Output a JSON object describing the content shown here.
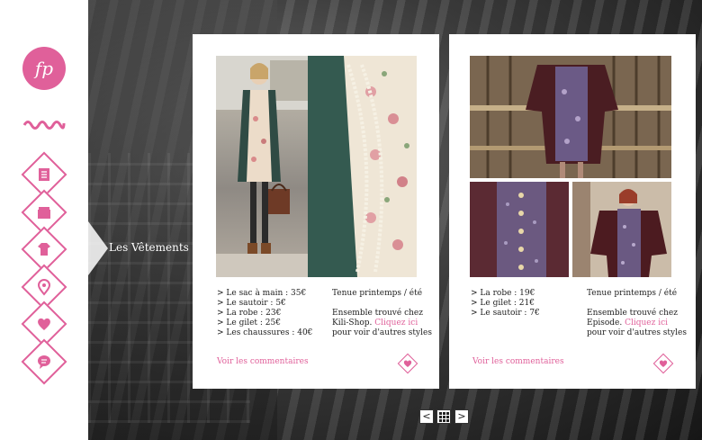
{
  "brand": {
    "logo_text": "fp",
    "accent": "#e0609a"
  },
  "nav": {
    "items": [
      {
        "id": "journal",
        "icon": "notebook-icon"
      },
      {
        "id": "shop",
        "icon": "shopping-bag-icon"
      },
      {
        "id": "clothes",
        "icon": "dress-icon"
      },
      {
        "id": "location",
        "icon": "location-pin-icon"
      },
      {
        "id": "favorites",
        "icon": "heart-icon"
      },
      {
        "id": "comments",
        "icon": "speech-bubble-icon"
      }
    ],
    "active_label": "Les Vêtements"
  },
  "cards": [
    {
      "items": [
        "> Le sac à main : 35€",
        "> Le sautoir : 5€",
        "> La robe : 23€",
        "> Le gilet : 25€",
        "> Les chaussures : 40€"
      ],
      "title": "Tenue  printemps / été",
      "found_line1": "Ensemble trouvé chez",
      "shop": "Kili-Shop.",
      "click_here": "Cliquez ici",
      "more_styles": "pour voir d'autres styles",
      "comments_link": "Voir les commentaires"
    },
    {
      "items": [
        "> La robe : 19€",
        "> Le gilet : 21€",
        "> Le sautoir : 7€"
      ],
      "title": "Tenue  printemps / été",
      "found_line1": "Ensemble trouvé chez",
      "shop": "Episode.",
      "click_here": "Cliquez ici",
      "more_styles": "pour voir d'autres styles",
      "comments_link": "Voir les commentaires"
    }
  ],
  "pager": {
    "prev": "<",
    "grid": "grid-icon",
    "next": ">"
  }
}
